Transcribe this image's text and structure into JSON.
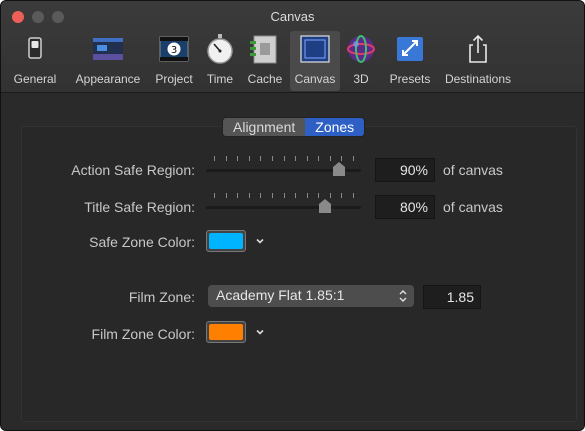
{
  "window": {
    "title": "Canvas"
  },
  "toolbar": {
    "items": [
      {
        "label": "General",
        "icon": "switch-icon"
      },
      {
        "label": "Appearance",
        "icon": "appearance-icon"
      },
      {
        "label": "Project",
        "icon": "film-project-icon"
      },
      {
        "label": "Time",
        "icon": "stopwatch-icon"
      },
      {
        "label": "Cache",
        "icon": "memory-icon"
      },
      {
        "label": "Canvas",
        "icon": "canvas-grid-icon",
        "active": true
      },
      {
        "label": "3D",
        "icon": "sphere-3d-icon"
      },
      {
        "label": "Presets",
        "icon": "presets-icon"
      },
      {
        "label": "Destinations",
        "icon": "share-icon"
      }
    ]
  },
  "tabs": {
    "alignment": "Alignment",
    "zones": "Zones",
    "selected": "Zones"
  },
  "action_safe": {
    "label": "Action Safe Region:",
    "value": "90%",
    "fraction": 0.9,
    "suffix": "of canvas"
  },
  "title_safe": {
    "label": "Title Safe Region:",
    "value": "80%",
    "fraction": 0.8,
    "suffix": "of canvas"
  },
  "safe_zone_color": {
    "label": "Safe Zone Color:",
    "color": "#00b4ff"
  },
  "film_zone": {
    "label": "Film Zone:",
    "selected": "Academy Flat 1.85:1",
    "ratio": "1.85"
  },
  "film_zone_color": {
    "label": "Film Zone Color:",
    "color": "#ff7f00"
  }
}
